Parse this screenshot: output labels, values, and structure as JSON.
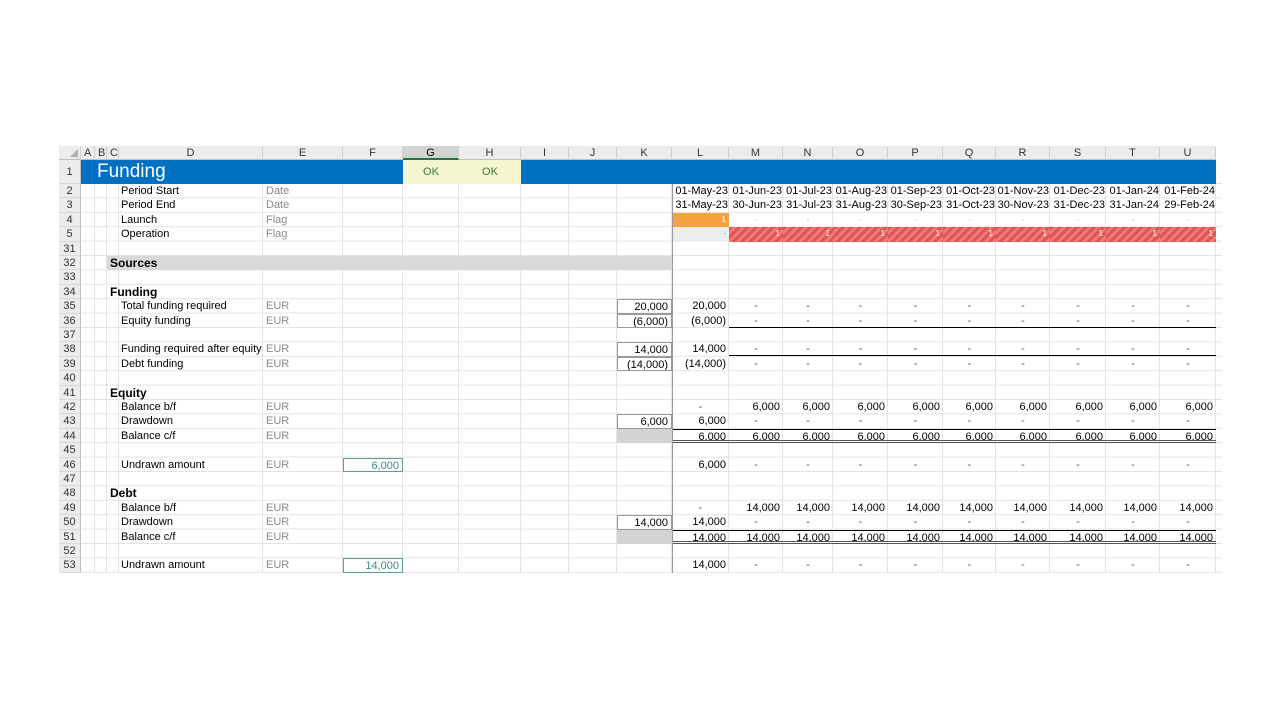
{
  "column_headers": [
    "A",
    "B",
    "C",
    "D",
    "E",
    "F",
    "G",
    "H",
    "I",
    "J",
    "K",
    "L",
    "M",
    "N",
    "O",
    "P",
    "Q",
    "R",
    "S",
    "T",
    "U"
  ],
  "row_numbers": [
    "1",
    "2",
    "3",
    "4",
    "5",
    "31",
    "32",
    "33",
    "34",
    "35",
    "36",
    "37",
    "38",
    "39",
    "40",
    "41",
    "42",
    "43",
    "44",
    "45",
    "46",
    "47",
    "48",
    "49",
    "50",
    "51",
    "52",
    "53"
  ],
  "sheet_title": "Funding",
  "checks": {
    "g": "OK",
    "h": "OK"
  },
  "timing": {
    "period_start_label": "Period Start",
    "period_end_label": "Period End",
    "launch_label": "Launch",
    "operation_label": "Operation",
    "date_unit": "Date",
    "flag_unit": "Flag",
    "period_start": [
      "01-May-23",
      "01-Jun-23",
      "01-Jul-23",
      "01-Aug-23",
      "01-Sep-23",
      "01-Oct-23",
      "01-Nov-23",
      "01-Dec-23",
      "01-Jan-24",
      "01-Feb-24"
    ],
    "period_end": [
      "31-May-23",
      "30-Jun-23",
      "31-Jul-23",
      "31-Aug-23",
      "30-Sep-23",
      "31-Oct-23",
      "30-Nov-23",
      "31-Dec-23",
      "31-Jan-24",
      "29-Feb-24"
    ],
    "launch_flags": [
      "1",
      "-",
      "-",
      "-",
      "-",
      "-",
      "-",
      "-",
      "-",
      "-"
    ],
    "operation_flags": [
      "-",
      "1",
      "1",
      "1",
      "1",
      "1",
      "1",
      "1",
      "1",
      "1"
    ]
  },
  "sources_heading": "Sources",
  "funding": {
    "heading": "Funding",
    "total_label": "Total funding required",
    "equity_label": "Equity funding",
    "after_equity_label": "Funding required after equity",
    "debt_label": "Debt funding",
    "unit": "EUR",
    "total_k": "20,000",
    "equity_k": "(6,000)",
    "after_equity_k": "14,000",
    "debt_k": "(14,000)",
    "total": [
      "20,000",
      "-",
      "-",
      "-",
      "-",
      "-",
      "-",
      "-",
      "-",
      "-"
    ],
    "equity": [
      "(6,000)",
      "-",
      "-",
      "-",
      "-",
      "-",
      "-",
      "-",
      "-",
      "-"
    ],
    "after_equity": [
      "14,000",
      "-",
      "-",
      "-",
      "-",
      "-",
      "-",
      "-",
      "-",
      "-"
    ],
    "debt": [
      "(14,000)",
      "-",
      "-",
      "-",
      "-",
      "-",
      "-",
      "-",
      "-",
      "-"
    ]
  },
  "equity": {
    "heading": "Equity",
    "bf_label": "Balance b/f",
    "drawdown_label": "Drawdown",
    "cf_label": "Balance c/f",
    "undrawn_label": "Undrawn amount",
    "unit": "EUR",
    "undrawn_input": "6,000",
    "drawdown_k": "6,000",
    "bf": [
      "-",
      "6,000",
      "6,000",
      "6,000",
      "6,000",
      "6,000",
      "6,000",
      "6,000",
      "6,000",
      "6,000"
    ],
    "drawdown": [
      "6,000",
      "-",
      "-",
      "-",
      "-",
      "-",
      "-",
      "-",
      "-",
      "-"
    ],
    "cf": [
      "6,000",
      "6,000",
      "6,000",
      "6,000",
      "6,000",
      "6,000",
      "6,000",
      "6,000",
      "6,000",
      "6,000"
    ],
    "undrawn": [
      "6,000",
      "-",
      "-",
      "-",
      "-",
      "-",
      "-",
      "-",
      "-",
      "-"
    ]
  },
  "debt": {
    "heading": "Debt",
    "bf_label": "Balance b/f",
    "drawdown_label": "Drawdown",
    "cf_label": "Balance c/f",
    "undrawn_label": "Undrawn amount",
    "unit": "EUR",
    "undrawn_input": "14,000",
    "drawdown_k": "14,000",
    "bf": [
      "-",
      "14,000",
      "14,000",
      "14,000",
      "14,000",
      "14,000",
      "14,000",
      "14,000",
      "14,000",
      "14,000"
    ],
    "drawdown": [
      "14,000",
      "-",
      "-",
      "-",
      "-",
      "-",
      "-",
      "-",
      "-",
      "-"
    ],
    "cf": [
      "14,000",
      "14,000",
      "14,000",
      "14,000",
      "14,000",
      "14,000",
      "14,000",
      "14,000",
      "14,000",
      "14,000"
    ],
    "undrawn": [
      "14,000",
      "-",
      "-",
      "-",
      "-",
      "-",
      "-",
      "-",
      "-",
      "-"
    ]
  },
  "colors": {
    "title_bar": "#0070c0",
    "ok_fill": "#f3f6cf",
    "ok_text": "#3b7a35",
    "launch_flag": "#f4a340",
    "operation_flag": "#e05454",
    "section_fill": "#d9d9d9",
    "input_border": "#5aa48c"
  }
}
